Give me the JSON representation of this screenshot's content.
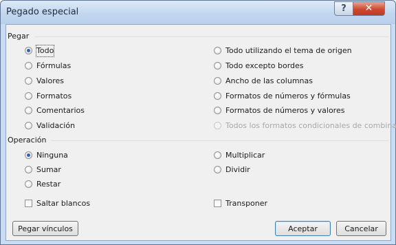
{
  "window": {
    "title": "Pegado especial",
    "help_glyph": "?",
    "close_glyph": "✕"
  },
  "pegar": {
    "label": "Pegar",
    "left": [
      {
        "label": "Todo",
        "selected": true
      },
      {
        "label": "Fórmulas",
        "selected": false
      },
      {
        "label": "Valores",
        "selected": false
      },
      {
        "label": "Formatos",
        "selected": false
      },
      {
        "label": "Comentarios",
        "selected": false
      },
      {
        "label": "Validación",
        "selected": false
      }
    ],
    "right": [
      {
        "label": "Todo utilizando el tema de origen",
        "selected": false,
        "enabled": true
      },
      {
        "label": "Todo excepto bordes",
        "selected": false,
        "enabled": true
      },
      {
        "label": "Ancho de las columnas",
        "selected": false,
        "enabled": true
      },
      {
        "label": "Formatos de números y fórmulas",
        "selected": false,
        "enabled": true
      },
      {
        "label": "Formatos de números y valores",
        "selected": false,
        "enabled": true
      },
      {
        "label": "Todos los formatos condicionales de combinación",
        "selected": false,
        "enabled": false
      }
    ]
  },
  "operacion": {
    "label": "Operación",
    "left": [
      {
        "label": "Ninguna",
        "selected": true
      },
      {
        "label": "Sumar",
        "selected": false
      },
      {
        "label": "Restar",
        "selected": false
      }
    ],
    "right": [
      {
        "label": "Multiplicar",
        "selected": false
      },
      {
        "label": "Dividir",
        "selected": false
      }
    ]
  },
  "checkboxes": {
    "saltar_blancos": {
      "label": "Saltar blancos",
      "checked": false
    },
    "transponer": {
      "label": "Transponer",
      "checked": false
    }
  },
  "buttons": {
    "pegar_vinculos": "Pegar vínculos",
    "aceptar": "Aceptar",
    "cancelar": "Cancelar"
  }
}
